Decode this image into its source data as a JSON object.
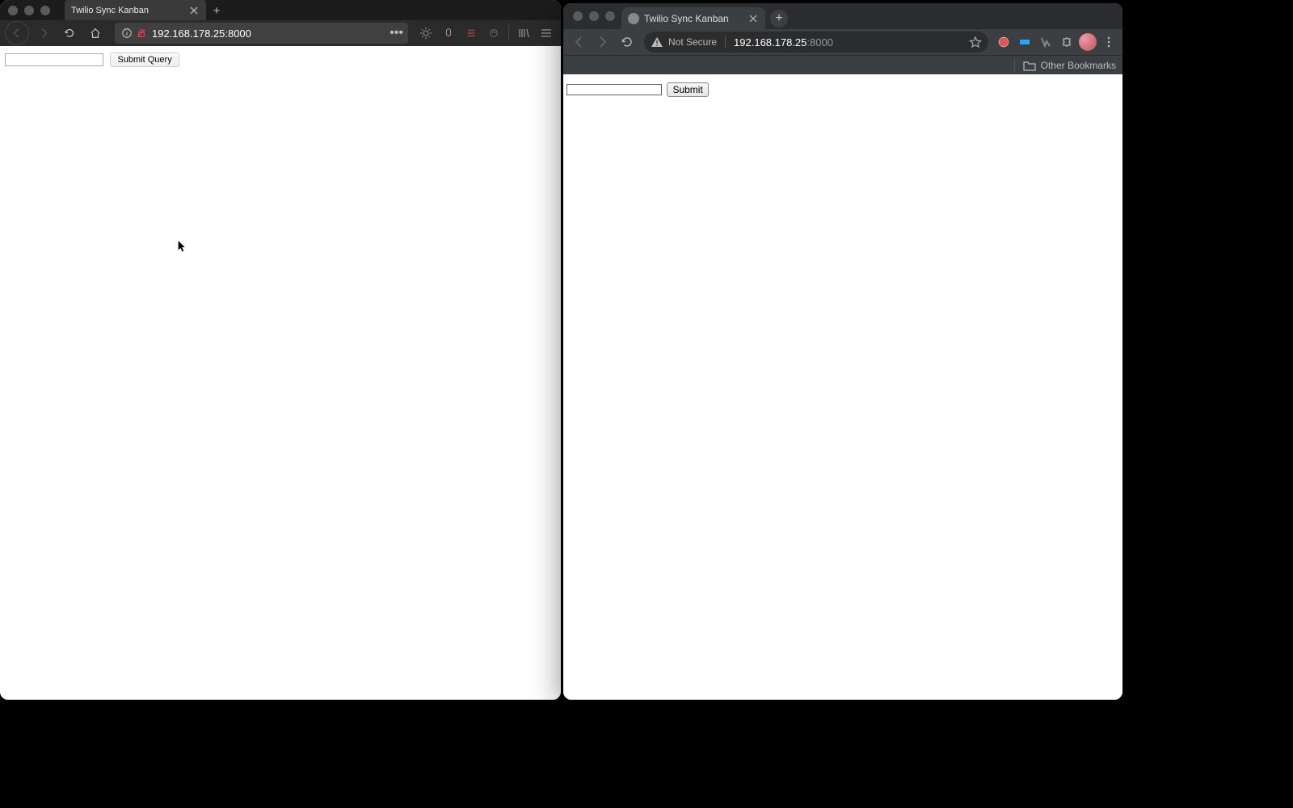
{
  "firefox": {
    "tab_title": "Twilio Sync Kanban",
    "url": "192.168.178.25:8000",
    "page": {
      "submit_label": "Submit Query",
      "input_value": ""
    }
  },
  "chrome": {
    "tab_title": "Twilio Sync Kanban",
    "not_secure_label": "Not Secure",
    "url_host": "192.168.178.25",
    "url_port": ":8000",
    "bookmarks_label": "Other Bookmarks",
    "page": {
      "submit_label": "Submit",
      "input_value": ""
    }
  }
}
